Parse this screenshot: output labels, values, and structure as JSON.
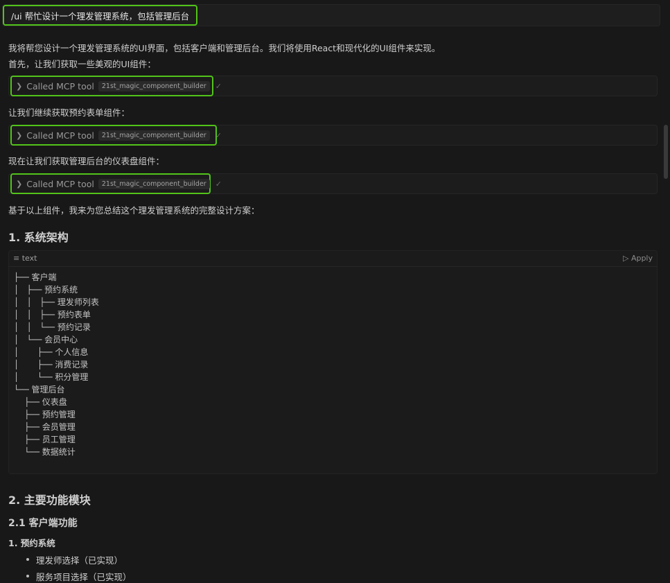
{
  "prompt": {
    "text": "/ui 帮忙设计一个理发管理系统，包括管理后台"
  },
  "intro": {
    "line1": "我将帮您设计一个理发管理系统的UI界面，包括客户端和管理后台。我们将使用React和现代化的UI组件来实现。",
    "line2": "首先，让我们获取一些美观的UI组件："
  },
  "tool_calls": [
    {
      "label": "Called MCP tool",
      "name": "21st_magic_component_builder",
      "check": "✓"
    },
    {
      "label": "Called MCP tool",
      "name": "21st_magic_component_builder",
      "check": "✓"
    },
    {
      "label": "Called MCP tool",
      "name": "21st_magic_component_builder",
      "check": "✓"
    }
  ],
  "captions": {
    "after_first": "让我们继续获取预约表单组件：",
    "after_second": "现在让我们获取管理后台的仪表盘组件：",
    "summary": "基于以上组件，我来为您总结这个理发管理系统的完整设计方案："
  },
  "section1": {
    "title": "1. 系统架构"
  },
  "code": {
    "lang": "text",
    "apply": "Apply",
    "lines": [
      "├── 客户端",
      "│   ├── 预约系统",
      "│   │   ├── 理发师列表",
      "│   │   ├── 预约表单",
      "│   │   └── 预约记录",
      "│   └── 会员中心",
      "│       ├── 个人信息",
      "│       ├── 消费记录",
      "│       └── 积分管理",
      "└── 管理后台",
      "    ├── 仪表盘",
      "    ├── 预约管理",
      "    ├── 会员管理",
      "    ├── 员工管理",
      "    └── 数据统计"
    ]
  },
  "section2": {
    "title": "2. 主要功能模块"
  },
  "subsection21": {
    "title": "2.1 客户端功能"
  },
  "subsub1": {
    "title": "1. 预约系统"
  },
  "bullets": [
    "理发师选择（已实现）",
    "服务项目选择（已实现）"
  ]
}
